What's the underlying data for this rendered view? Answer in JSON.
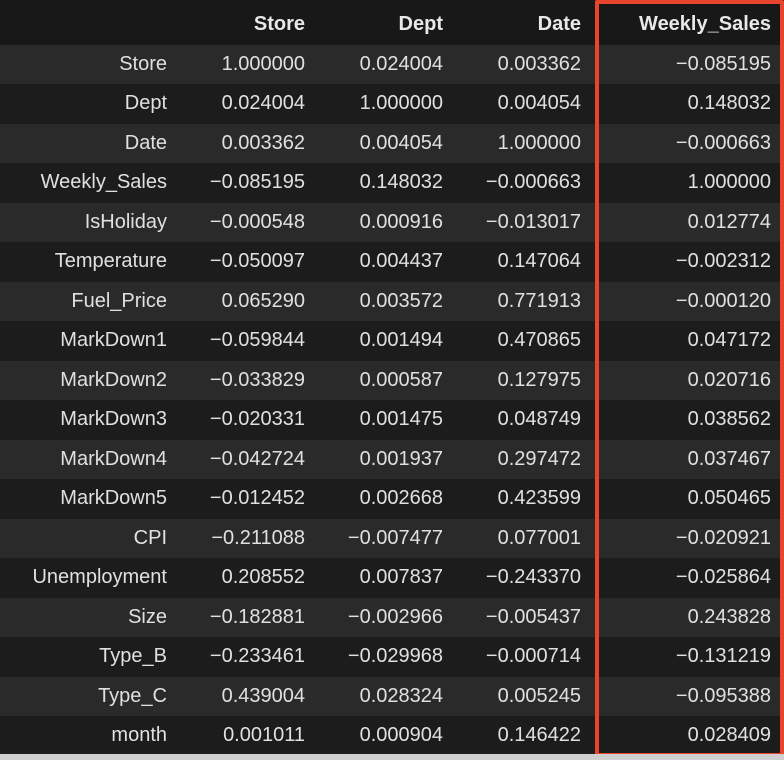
{
  "table": {
    "columns": [
      "Store",
      "Dept",
      "Date",
      "Weekly_Sales"
    ],
    "rows": [
      {
        "label": "Store",
        "values": [
          "1.000000",
          "0.024004",
          "0.003362",
          "-0.085195"
        ]
      },
      {
        "label": "Dept",
        "values": [
          "0.024004",
          "1.000000",
          "0.004054",
          "0.148032"
        ]
      },
      {
        "label": "Date",
        "values": [
          "0.003362",
          "0.004054",
          "1.000000",
          "-0.000663"
        ]
      },
      {
        "label": "Weekly_Sales",
        "values": [
          "-0.085195",
          "0.148032",
          "-0.000663",
          "1.000000"
        ]
      },
      {
        "label": "IsHoliday",
        "values": [
          "-0.000548",
          "0.000916",
          "-0.013017",
          "0.012774"
        ]
      },
      {
        "label": "Temperature",
        "values": [
          "-0.050097",
          "0.004437",
          "0.147064",
          "-0.002312"
        ]
      },
      {
        "label": "Fuel_Price",
        "values": [
          "0.065290",
          "0.003572",
          "0.771913",
          "-0.000120"
        ]
      },
      {
        "label": "MarkDown1",
        "values": [
          "-0.059844",
          "0.001494",
          "0.470865",
          "0.047172"
        ]
      },
      {
        "label": "MarkDown2",
        "values": [
          "-0.033829",
          "0.000587",
          "0.127975",
          "0.020716"
        ]
      },
      {
        "label": "MarkDown3",
        "values": [
          "-0.020331",
          "0.001475",
          "0.048749",
          "0.038562"
        ]
      },
      {
        "label": "MarkDown4",
        "values": [
          "-0.042724",
          "0.001937",
          "0.297472",
          "0.037467"
        ]
      },
      {
        "label": "MarkDown5",
        "values": [
          "-0.012452",
          "0.002668",
          "0.423599",
          "0.050465"
        ]
      },
      {
        "label": "CPI",
        "values": [
          "-0.211088",
          "-0.007477",
          "0.077001",
          "-0.020921"
        ]
      },
      {
        "label": "Unemployment",
        "values": [
          "0.208552",
          "0.007837",
          "-0.243370",
          "-0.025864"
        ]
      },
      {
        "label": "Size",
        "values": [
          "-0.182881",
          "-0.002966",
          "-0.005437",
          "0.243828"
        ]
      },
      {
        "label": "Type_B",
        "values": [
          "-0.233461",
          "-0.029968",
          "-0.000714",
          "-0.131219"
        ]
      },
      {
        "label": "Type_C",
        "values": [
          "0.439004",
          "0.028324",
          "0.005245",
          "-0.095388"
        ]
      },
      {
        "label": "month",
        "values": [
          "0.001011",
          "0.000904",
          "0.146422",
          "0.028409"
        ]
      }
    ]
  },
  "colors": {
    "highlight_border": "#e8452c",
    "row_odd": "#2a2a2a",
    "row_even": "#1c1c1c"
  }
}
